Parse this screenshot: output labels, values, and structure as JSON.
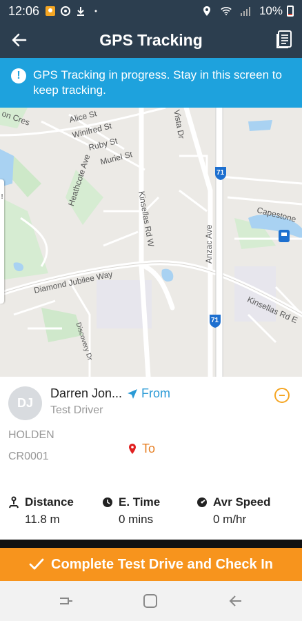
{
  "status_bar": {
    "time": "12:06",
    "battery": "10%"
  },
  "app_bar": {
    "title": "GPS Tracking"
  },
  "banner": {
    "message": "GPS Tracking in progress. Stay in this screen to keep tracking.",
    "icon": "!"
  },
  "map": {
    "labels": {
      "alice": "Alice St",
      "winifred": "Winifred St",
      "ruby": "Ruby St",
      "muriel": "Muriel St",
      "on_cres": "on Cres",
      "heathcote": "Heathcote Ave",
      "kinsellas_w": "Kinsellas Rd W",
      "anzac": "Anzac Ave",
      "diamond": "Diamond Jubilee Way",
      "kinsellas_e": "Kinsellas Rd E",
      "discovery": "Discovery Dr",
      "capestone": "Capestone",
      "vista": "Vista Dr",
      "route1": "71",
      "route2": "71"
    }
  },
  "driver": {
    "initials": "DJ",
    "name": "Darren Jon...",
    "role": "Test Driver",
    "from_label": "From",
    "to_label": "To"
  },
  "vehicle": {
    "make": "HOLDEN",
    "plate": "CR0001"
  },
  "stats": {
    "distance": {
      "label": "Distance",
      "value": "11.8 m"
    },
    "time": {
      "label": "E. Time",
      "value": "0 mins"
    },
    "speed": {
      "label": "Avr Speed",
      "value": "0 m/hr"
    }
  },
  "cta": {
    "label": "Complete Test Drive and Check In"
  },
  "colors": {
    "header": "#2c3e4f",
    "banner": "#1ea2dd",
    "accent_orange": "#f7941d",
    "link_blue": "#2a9ad6"
  }
}
